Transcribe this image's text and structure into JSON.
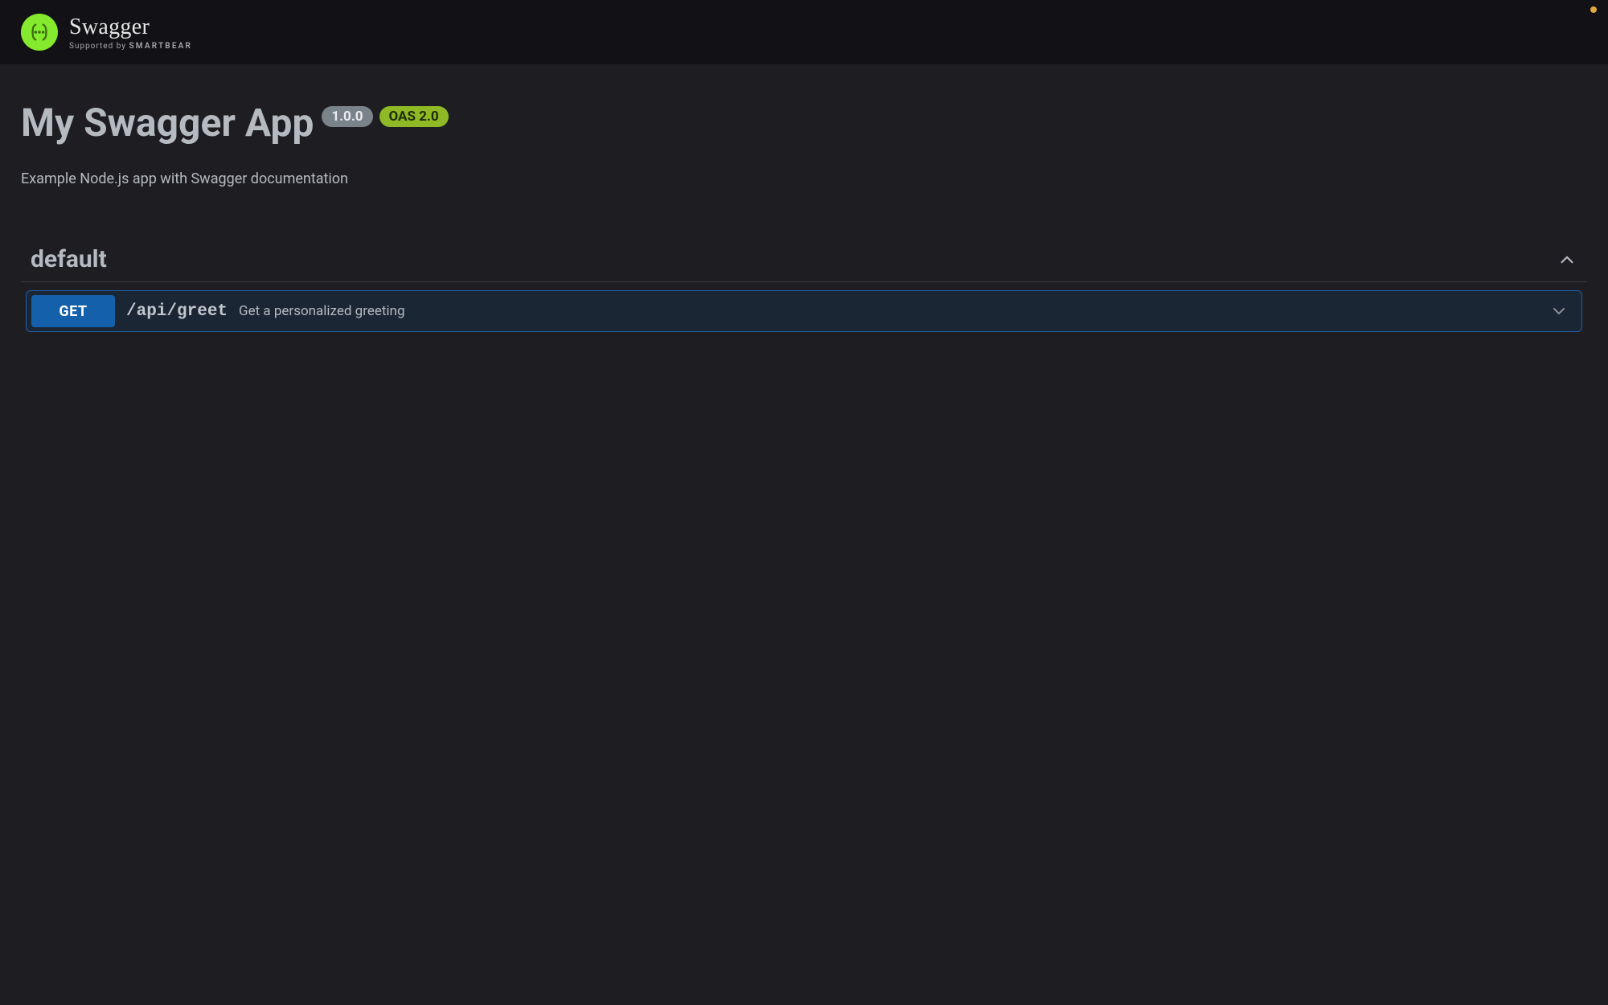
{
  "brand": {
    "name": "Swagger",
    "supported_prefix": "Supported by ",
    "supported_by": "SMARTBEAR"
  },
  "info": {
    "title": "My Swagger App",
    "version": "1.0.0",
    "oas_badge": "OAS 2.0",
    "description": "Example Node.js app with Swagger documentation"
  },
  "tag": {
    "name": "default"
  },
  "operation": {
    "method": "GET",
    "path": "/api/greet",
    "summary": "Get a personalized greeting"
  },
  "colors": {
    "get": "#1460aa",
    "oas": "#8fb925",
    "accent": "#85ea2d"
  }
}
